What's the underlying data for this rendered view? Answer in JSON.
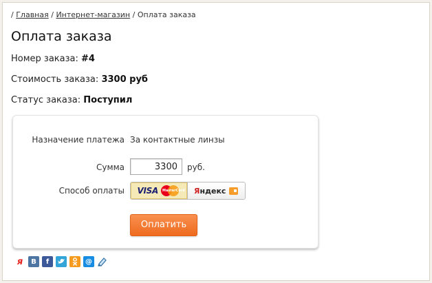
{
  "breadcrumb": {
    "prefix": "/",
    "home": "Главная",
    "sep1": "/",
    "shop": "Интернет-магазин",
    "sep2": "/",
    "current": "Оплата заказа"
  },
  "page_title": "Оплата заказа",
  "order": {
    "number_label": "Номер заказа:",
    "number_value": "#4",
    "cost_label": "Стоимость заказа:",
    "cost_value": "3300 руб",
    "status_label": "Статус заказа:",
    "status_value": "Поступил"
  },
  "payment_form": {
    "purpose_label": "Назначение платежа",
    "purpose_value": "За контактные линзы",
    "amount_label": "Сумма",
    "amount_value": "3300",
    "currency": "руб.",
    "method_label": "Способ оплаты",
    "methods": {
      "card_visa": "VISA",
      "card_mastercard": "MasterCard",
      "yandex_prefix": "Я",
      "yandex_rest": "ндекс",
      "selected": "card"
    },
    "submit_label": "Оплатить"
  },
  "share_icons": [
    "yaru-icon",
    "vkontakte-icon",
    "facebook-icon",
    "twitter-icon",
    "odnoklassniki-icon",
    "mailru-icon",
    "livejournal-icon"
  ],
  "colors": {
    "pay_button": "#ee6b1f",
    "selected_method_bg": "#f6e9b8"
  }
}
